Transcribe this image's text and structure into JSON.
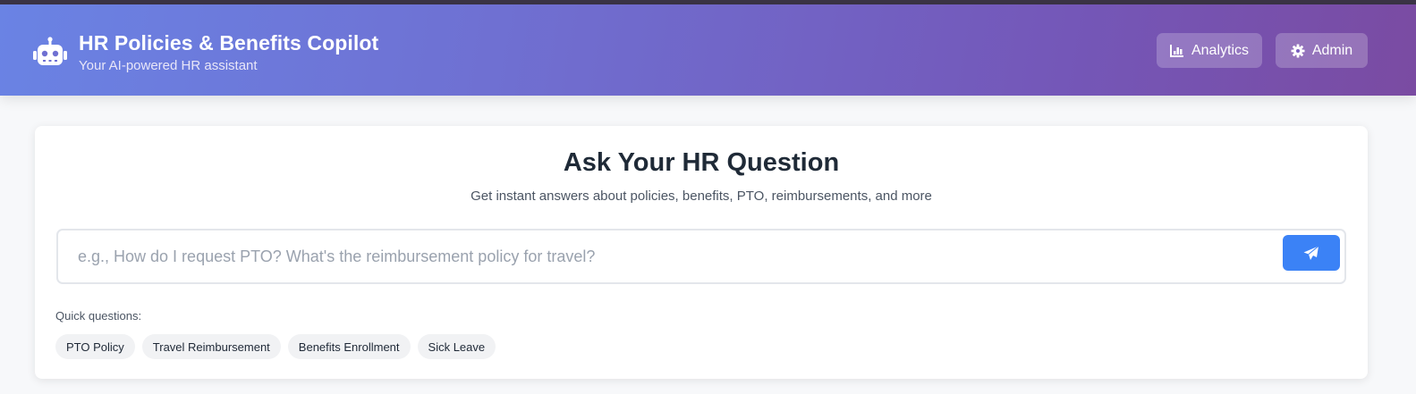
{
  "header": {
    "title": "HR Policies & Benefits Copilot",
    "subtitle": "Your AI-powered HR assistant",
    "brand_icon": "robot-icon",
    "buttons": {
      "analytics": {
        "label": "Analytics",
        "icon": "bar-chart-icon"
      },
      "admin": {
        "label": "Admin",
        "icon": "gear-icon"
      }
    }
  },
  "main": {
    "title": "Ask Your HR Question",
    "subtitle": "Get instant answers about policies, benefits, PTO, reimbursements, and more",
    "search": {
      "placeholder": "e.g., How do I request PTO? What's the reimbursement policy for travel?",
      "value": "",
      "send_icon": "paper-plane-icon"
    },
    "quick_label": "Quick questions:",
    "quick_questions": [
      "PTO Policy",
      "Travel Reimbursement",
      "Benefits Enrollment",
      "Sick Leave"
    ]
  },
  "colors": {
    "header_gradient_start": "#6a83e4",
    "header_gradient_end": "#7a4ba2",
    "accent": "#3b82f6"
  }
}
